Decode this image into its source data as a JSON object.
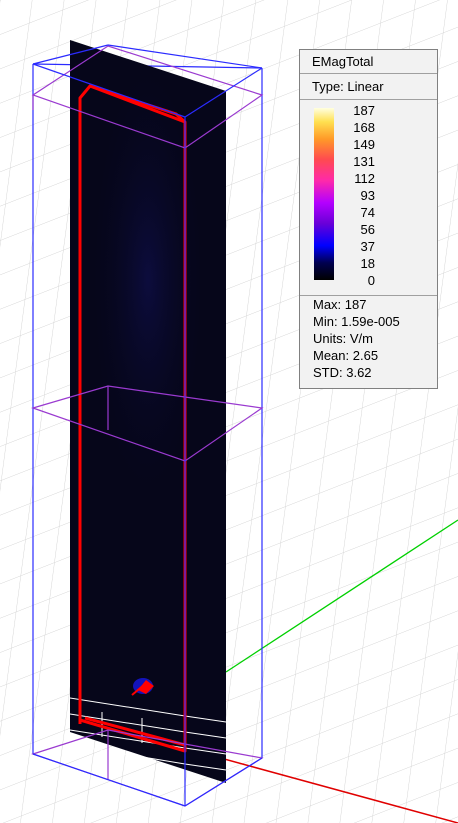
{
  "legend": {
    "title": "EMagTotal",
    "type_label": "Type: Linear",
    "ticks": [
      "187",
      "168",
      "149",
      "131",
      "112",
      "93",
      "74",
      "56",
      "37",
      "18",
      "0"
    ],
    "stats": {
      "max": "Max: 187",
      "min": "Min: 1.59e-005",
      "units": "Units: V/m",
      "mean": "Mean: 2.65",
      "std": "STD: 3.62"
    }
  },
  "colors": {
    "background": "#ffffff",
    "grid": "#d6d6d6",
    "field_plane": "#06061a",
    "air_box": "#2b2bff",
    "port_box": "#9a3ad0",
    "trace": "#ff0000",
    "axis_x": "#e00000",
    "axis_y": "#00d000"
  }
}
